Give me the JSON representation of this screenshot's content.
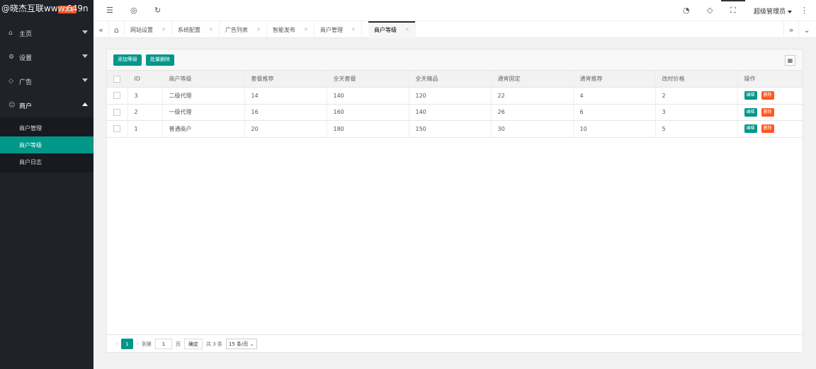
{
  "watermark": "@晓杰互联www.649n",
  "logo": {
    "badge": "V1.1"
  },
  "sidebar": {
    "items": [
      {
        "label": "主页",
        "icon": "home-icon"
      },
      {
        "label": "设置",
        "icon": "gear-icon"
      },
      {
        "label": "广告",
        "icon": "diamond-icon"
      },
      {
        "label": "商户",
        "icon": "user-icon"
      }
    ],
    "sub_items": [
      "商户管理",
      "商户等级",
      "商户日志"
    ],
    "active_sub": "商户等级"
  },
  "header": {
    "user": "超级管理员"
  },
  "tabs": [
    {
      "label": "网站设置"
    },
    {
      "label": "系统配置"
    },
    {
      "label": "广告列表"
    },
    {
      "label": "智能发布"
    },
    {
      "label": "商户管理"
    },
    {
      "label": "商户等级"
    }
  ],
  "toolbar": {
    "add_label": "添加等级",
    "batch_delete_label": "批量删除"
  },
  "table": {
    "columns": [
      "ID",
      "商户等级",
      "套餐推荐",
      "全天套餐",
      "全天精品",
      "通宵固定",
      "通宵推荐",
      "改时价格",
      "操作"
    ],
    "rows": [
      [
        "3",
        "二级代理",
        "14",
        "140",
        "120",
        "22",
        "4",
        "2"
      ],
      [
        "2",
        "一级代理",
        "16",
        "160",
        "140",
        "26",
        "6",
        "3"
      ],
      [
        "1",
        "普通商户",
        "20",
        "180",
        "150",
        "30",
        "10",
        "5"
      ]
    ],
    "edit_label": "编辑",
    "delete_label": "删除"
  },
  "pager": {
    "current": "1",
    "goto_label": "到第",
    "goto_value": "1",
    "page_unit": "页",
    "confirm_label": "确定",
    "total_label": "共 3 条",
    "page_size": "15 条/页"
  },
  "colors": {
    "accent": "#009688",
    "danger": "#ff5722",
    "sidebar": "#20222a"
  }
}
